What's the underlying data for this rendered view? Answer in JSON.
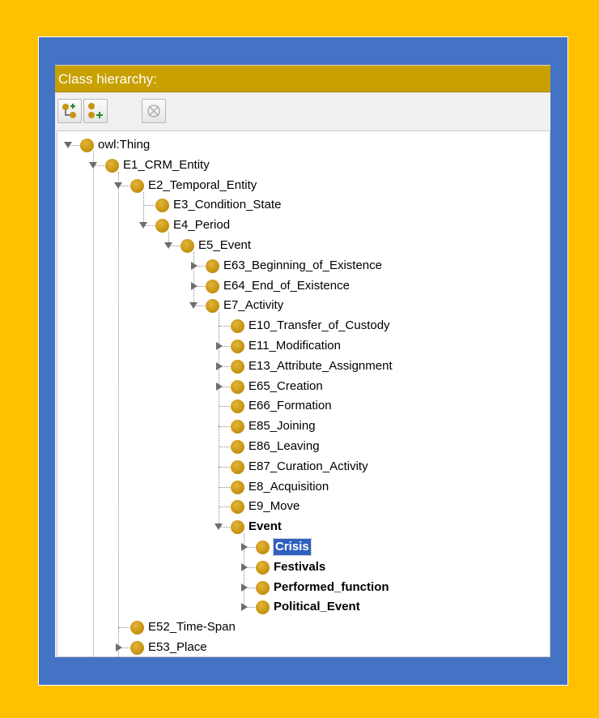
{
  "panel": {
    "title": "Class hierarchy:",
    "toolbar": [
      {
        "icon": "add-subclass-icon"
      },
      {
        "icon": "add-sibling-icon"
      },
      {
        "icon": "delete-class-icon"
      }
    ]
  },
  "tree": [
    {
      "label": "owl:Thing",
      "depth": 0,
      "toggle": "open"
    },
    {
      "label": "E1_CRM_Entity",
      "depth": 1,
      "toggle": "open"
    },
    {
      "label": "E2_Temporal_Entity",
      "depth": 2,
      "toggle": "open"
    },
    {
      "label": "E3_Condition_State",
      "depth": 3,
      "toggle": "none"
    },
    {
      "label": "E4_Period",
      "depth": 3,
      "toggle": "open"
    },
    {
      "label": "E5_Event",
      "depth": 4,
      "toggle": "open"
    },
    {
      "label": "E63_Beginning_of_Existence",
      "depth": 5,
      "toggle": "closed"
    },
    {
      "label": "E64_End_of_Existence",
      "depth": 5,
      "toggle": "closed"
    },
    {
      "label": "E7_Activity",
      "depth": 5,
      "toggle": "open"
    },
    {
      "label": "E10_Transfer_of_Custody",
      "depth": 6,
      "toggle": "none"
    },
    {
      "label": "E11_Modification",
      "depth": 6,
      "toggle": "closed"
    },
    {
      "label": "E13_Attribute_Assignment",
      "depth": 6,
      "toggle": "closed"
    },
    {
      "label": "E65_Creation",
      "depth": 6,
      "toggle": "closed"
    },
    {
      "label": "E66_Formation",
      "depth": 6,
      "toggle": "none"
    },
    {
      "label": "E85_Joining",
      "depth": 6,
      "toggle": "none"
    },
    {
      "label": "E86_Leaving",
      "depth": 6,
      "toggle": "none"
    },
    {
      "label": "E87_Curation_Activity",
      "depth": 6,
      "toggle": "none"
    },
    {
      "label": "E8_Acquisition",
      "depth": 6,
      "toggle": "none"
    },
    {
      "label": "E9_Move",
      "depth": 6,
      "toggle": "none"
    },
    {
      "label": "Event",
      "depth": 6,
      "toggle": "open",
      "bold": true
    },
    {
      "label": "Crisis",
      "depth": 7,
      "toggle": "closed",
      "bold": true,
      "selected": true
    },
    {
      "label": "Festivals",
      "depth": 7,
      "toggle": "closed",
      "bold": true
    },
    {
      "label": "Performed_function",
      "depth": 7,
      "toggle": "closed",
      "bold": true
    },
    {
      "label": "Political_Event",
      "depth": 7,
      "toggle": "closed",
      "bold": true
    },
    {
      "label": "E52_Time-Span",
      "depth": 2,
      "toggle": "none"
    },
    {
      "label": "E53_Place",
      "depth": 2,
      "toggle": "closed"
    }
  ]
}
